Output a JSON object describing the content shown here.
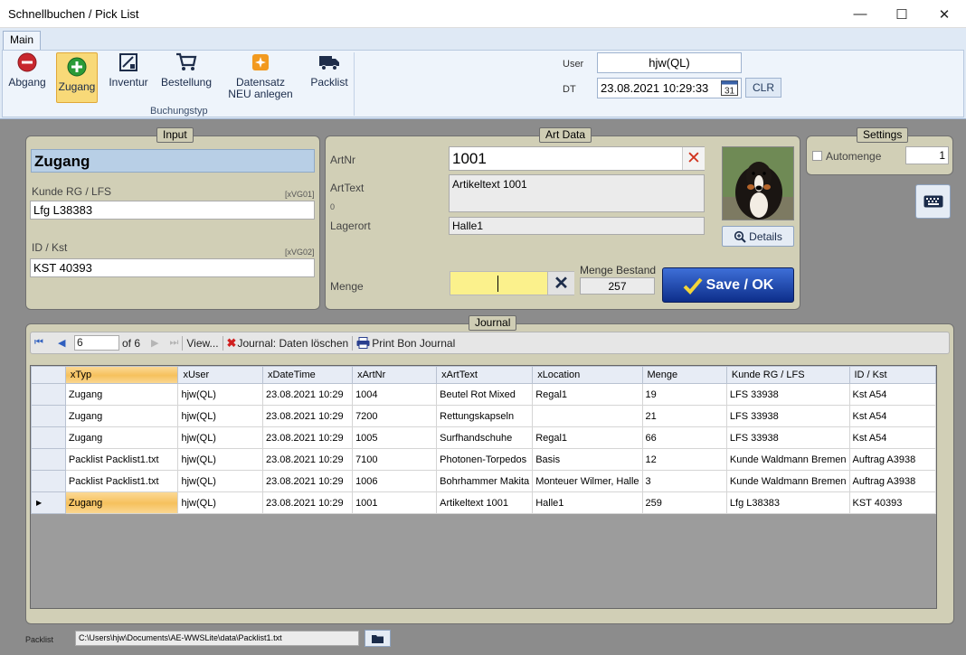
{
  "window": {
    "title": "Schnellbuchen / Pick List",
    "minimize": "—",
    "maximize": "☐",
    "close": "✕"
  },
  "ribbon": {
    "tab": "Main",
    "buttons": [
      {
        "label": "Abgang",
        "icon": "minus-circle-icon"
      },
      {
        "label": "Zugang",
        "icon": "plus-circle-icon"
      },
      {
        "label": "Inventur",
        "icon": "inventory-icon"
      },
      {
        "label": "Bestellung",
        "icon": "cart-icon"
      },
      {
        "label": "Datensatz NEU anlegen",
        "icon": "new-record-icon"
      },
      {
        "label": "Packlist",
        "icon": "truck-icon"
      }
    ],
    "group_label": "Buchungstyp",
    "user_label": "User",
    "user_value": "hjw(QL)",
    "dt_label": "DT",
    "dt_value": "23.08.2021 10:29:33",
    "clr_label": "CLR"
  },
  "input": {
    "title": "Input",
    "type_value": "Zugang",
    "kunde_label": "Kunde RG / LFS",
    "kunde_code": "[xVG01]",
    "kunde_value": "Lfg L38383",
    "id_label": "ID / Kst",
    "id_code": "[xVG02]",
    "id_value": "KST 40393"
  },
  "art": {
    "title": "Art Data",
    "artnr_label": "ArtNr",
    "artnr_value": "1001",
    "arttext_label": "ArtText",
    "arttext_value": "Artikeltext 1001",
    "zero": "0",
    "lager_label": "Lagerort",
    "lager_value": "Halle1",
    "menge_label": "Menge",
    "menge_value": "",
    "bestand_label": "Menge Bestand",
    "bestand_value": "257",
    "details_label": "Details",
    "save_label": "Save / OK"
  },
  "settings": {
    "title": "Settings",
    "automenge_label": "Automenge",
    "automenge_value": "1"
  },
  "journal": {
    "title": "Journal",
    "page": "6",
    "of": "of 6",
    "view": "View...",
    "delete": "Journal: Daten löschen",
    "print": "Print Bon Journal",
    "columns": [
      "xTyp",
      "xUser",
      "xDateTime",
      "xArtNr",
      "xArtText",
      "xLocation",
      "Menge",
      "Kunde RG / LFS",
      "ID / Kst"
    ],
    "rows": [
      [
        "Zugang",
        "hjw(QL)",
        "23.08.2021 10:29",
        "1004",
        "Beutel Rot Mixed",
        "Regal1",
        "19",
        "LFS 33938",
        "Kst A54"
      ],
      [
        "Zugang",
        "hjw(QL)",
        "23.08.2021 10:29",
        "7200",
        "Rettungskapseln",
        "",
        "21",
        "LFS 33938",
        "Kst A54"
      ],
      [
        "Zugang",
        "hjw(QL)",
        "23.08.2021 10:29",
        "1005",
        "Surfhandschuhe",
        "Regal1",
        "66",
        "LFS 33938",
        "Kst A54"
      ],
      [
        "Packlist Packlist1.txt",
        "hjw(QL)",
        "23.08.2021 10:29",
        "7100",
        "Photonen-Torpedos",
        "Basis",
        "12",
        "Kunde Waldmann Bremen",
        "Auftrag A3938"
      ],
      [
        "Packlist Packlist1.txt",
        "hjw(QL)",
        "23.08.2021 10:29",
        "1006",
        "Bohrhammer Makita",
        "Monteuer Wilmer, Halle",
        "3",
        "Kunde Waldmann Bremen",
        "Auftrag A3938"
      ],
      [
        "Zugang",
        "hjw(QL)",
        "23.08.2021 10:29",
        "1001",
        "Artikeltext 1001",
        "Halle1",
        "259",
        "Lfg L38383",
        "KST 40393"
      ]
    ]
  },
  "footer": {
    "packlist_label": "Packlist",
    "packlist_path": "C:\\Users\\hjw\\Documents\\AE-WWSLite\\data\\Packlist1.txt"
  }
}
